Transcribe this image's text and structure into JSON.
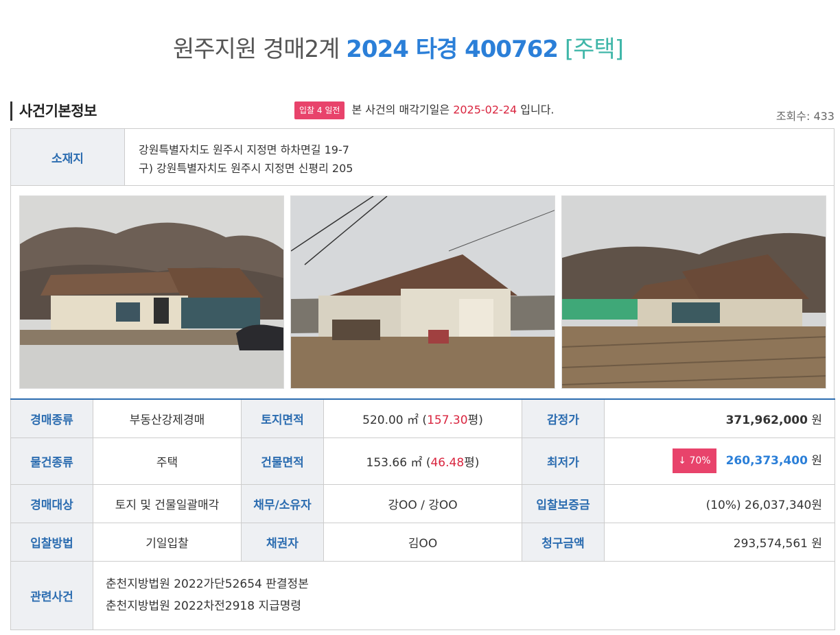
{
  "header": {
    "court": "원주지원 경매2계",
    "case_no": "2024 타경 400762",
    "property_type": "[주택]"
  },
  "section": {
    "title": "사건기본정보",
    "badge": "입찰 4 일전",
    "notice_prefix": "본 사건의 매각기일은",
    "sale_date": "2025-02-24",
    "notice_suffix": "입니다.",
    "views": "조회수: 433"
  },
  "location": {
    "label": "소재지",
    "address": "강원특별자치도 원주시 지정면 하차면길 19-7",
    "old_address": "구) 강원특별자치도 원주시 지정면 신평리 205"
  },
  "photos": [
    "house-front-photo",
    "house-side-photo",
    "house-field-photo"
  ],
  "info": {
    "auction_type_label": "경매종류",
    "auction_type": "부동산강제경매",
    "land_area_label": "토지면적",
    "land_area_m2": "520.00 ㎡ (",
    "land_area_py": "157.30",
    "land_area_unit": "평)",
    "appraisal_label": "감정가",
    "appraisal": "371,962,000",
    "won": "원",
    "item_type_label": "물건종류",
    "item_type": "주택",
    "building_area_label": "건물면적",
    "building_area_m2": "153.66 ㎡ (",
    "building_area_py": "46.48",
    "building_area_unit": "평)",
    "min_price_label": "최저가",
    "min_pct": "↓ 70%",
    "min_price": "260,373,400",
    "target_label": "경매대상",
    "target": "토지 및 건물일괄매각",
    "debtor_label": "채무/소유자",
    "debtor": "강OO / 강OO",
    "deposit_label": "입찰보증금",
    "deposit": "(10%) 26,037,340원",
    "method_label": "입찰방법",
    "method": "기일입찰",
    "creditor_label": "채권자",
    "creditor": "김OO",
    "claim_label": "청구금액",
    "claim": "293,574,561 원",
    "related_label": "관련사건",
    "related": [
      "춘천지방법원 2022가단52654 판결정본",
      "춘천지방법원 2022차전2918 지급명령"
    ]
  },
  "colors": {
    "accent_blue": "#2b7fd8",
    "accent_red": "#d9253f",
    "badge_pink": "#e8436b",
    "teal": "#3fb6a8"
  }
}
